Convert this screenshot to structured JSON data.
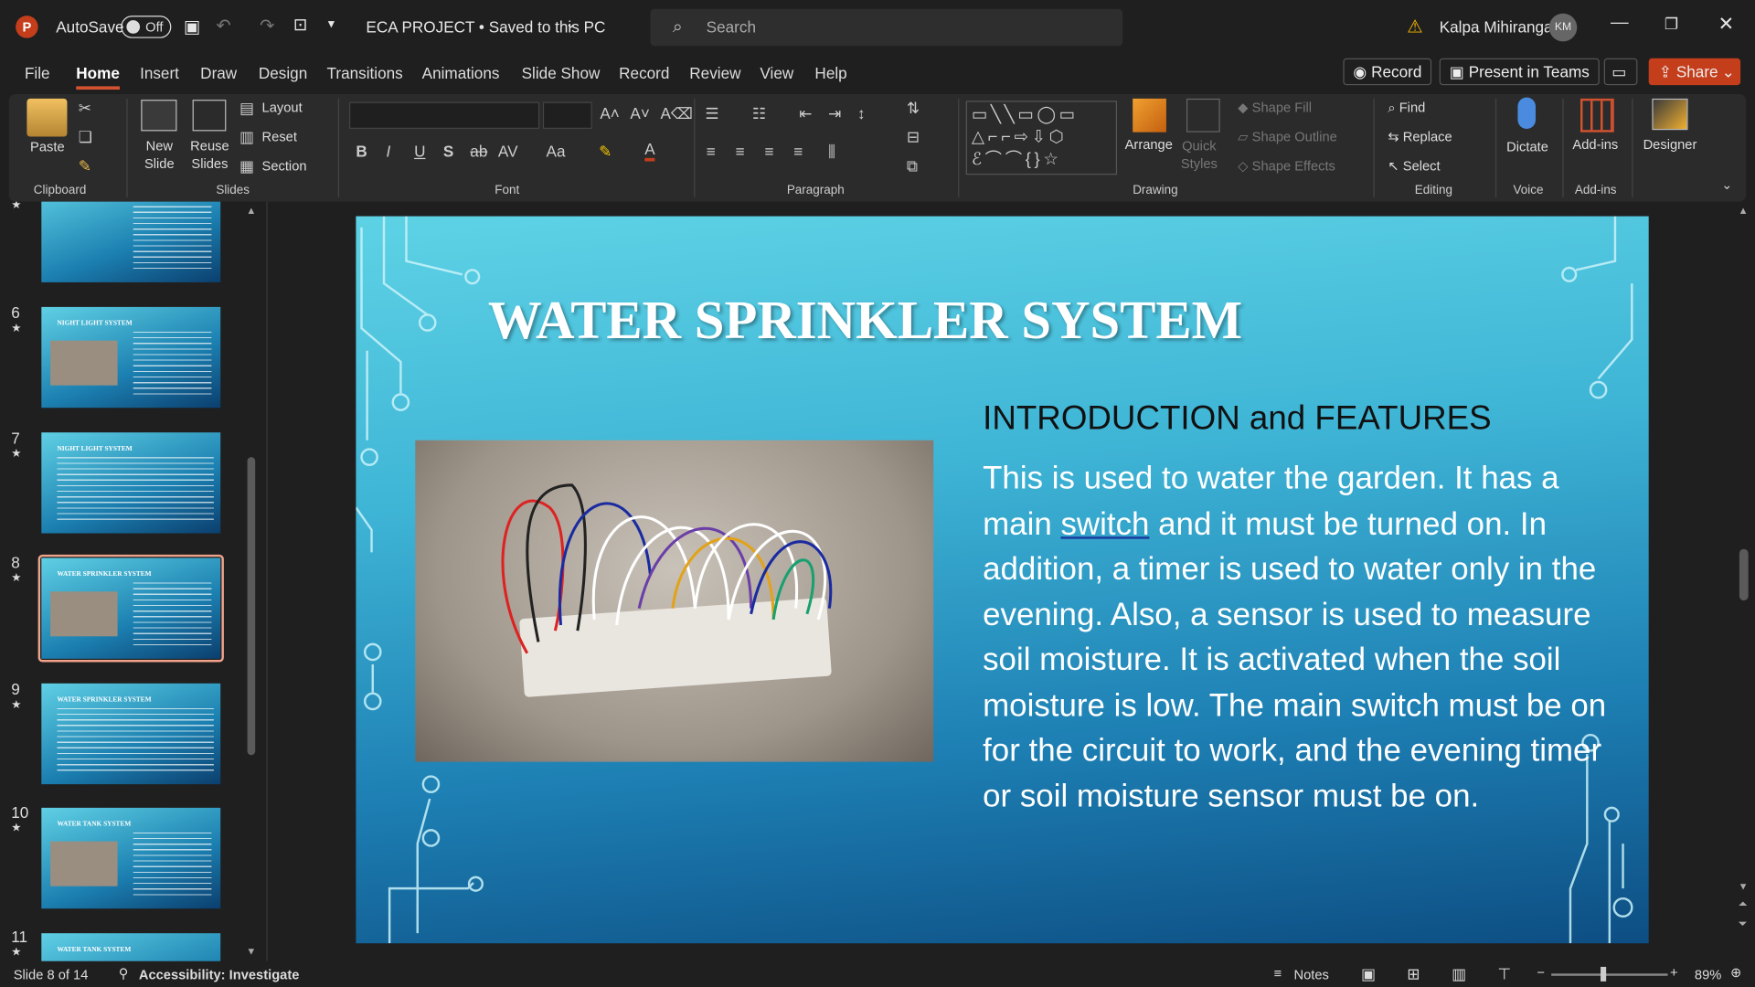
{
  "titlebar": {
    "app_letter": "P",
    "autosave": "AutoSave",
    "toggle": "Off",
    "doc_title": "ECA PROJECT • Saved to this PC",
    "search_placeholder": "Search",
    "user": "Kalpa Mihiranga",
    "initials": "KM"
  },
  "menu": {
    "items": [
      "File",
      "Home",
      "Insert",
      "Draw",
      "Design",
      "Transitions",
      "Animations",
      "Slide Show",
      "Record",
      "Review",
      "View",
      "Help"
    ],
    "active": "Home",
    "record": "Record",
    "present": "Present in Teams",
    "share": "Share"
  },
  "ribbon": {
    "clipboard": {
      "paste": "Paste",
      "label": "Clipboard"
    },
    "slides": {
      "new": "New",
      "slide": "Slide",
      "reuse": "Reuse",
      "slides2": "Slides",
      "layout": "Layout",
      "reset": "Reset",
      "section": "Section",
      "label": "Slides"
    },
    "font": {
      "label": "Font",
      "b": "B",
      "i": "I",
      "u": "U",
      "s": "S",
      "ab": "ab",
      "av": "AV",
      "aa": "Aa"
    },
    "paragraph": {
      "label": "Paragraph"
    },
    "drawing": {
      "arrange": "Arrange",
      "quick": "Quick",
      "styles": "Styles",
      "fill": "Shape Fill",
      "outline": "Shape Outline",
      "effects": "Shape Effects",
      "label": "Drawing"
    },
    "editing": {
      "find": "Find",
      "replace": "Replace",
      "select": "Select",
      "label": "Editing"
    },
    "voice": {
      "dictate": "Dictate",
      "label": "Voice"
    },
    "addins": {
      "btn": "Add-ins",
      "label": "Add-ins"
    },
    "designer": "Designer"
  },
  "thumbs": [
    {
      "num": "",
      "title": ""
    },
    {
      "num": "6",
      "title": "NIGHT LIGHT SYSTEM"
    },
    {
      "num": "7",
      "title": "NIGHT LIGHT SYSTEM"
    },
    {
      "num": "8",
      "title": "WATER SPRINKLER SYSTEM"
    },
    {
      "num": "9",
      "title": "WATER SPRINKLER SYSTEM"
    },
    {
      "num": "10",
      "title": "WATER TANK SYSTEM"
    },
    {
      "num": "11",
      "title": "WATER TANK SYSTEM"
    }
  ],
  "slide": {
    "title": "WATER SPRINKLER SYSTEM",
    "subtitle": "INTRODUCTION and FEATURES",
    "body_pre": "This is used to water the garden. It has a main ",
    "body_link": "switch",
    "body_post": " and it must be turned on. In addition, a timer is used to water only in the evening. Also, a sensor is used to measure soil moisture. It is activated when the soil moisture is low. The main switch must be on for the circuit to work, and the evening timer or soil moisture sensor must be on."
  },
  "status": {
    "slide": "Slide 8 of 14",
    "accessibility": "Accessibility: Investigate",
    "notes": "Notes",
    "zoom": "89%"
  },
  "colors": {
    "accent": "#c43e1c",
    "share": "#c43e1c",
    "selected_thumb": "#f0a38a"
  }
}
